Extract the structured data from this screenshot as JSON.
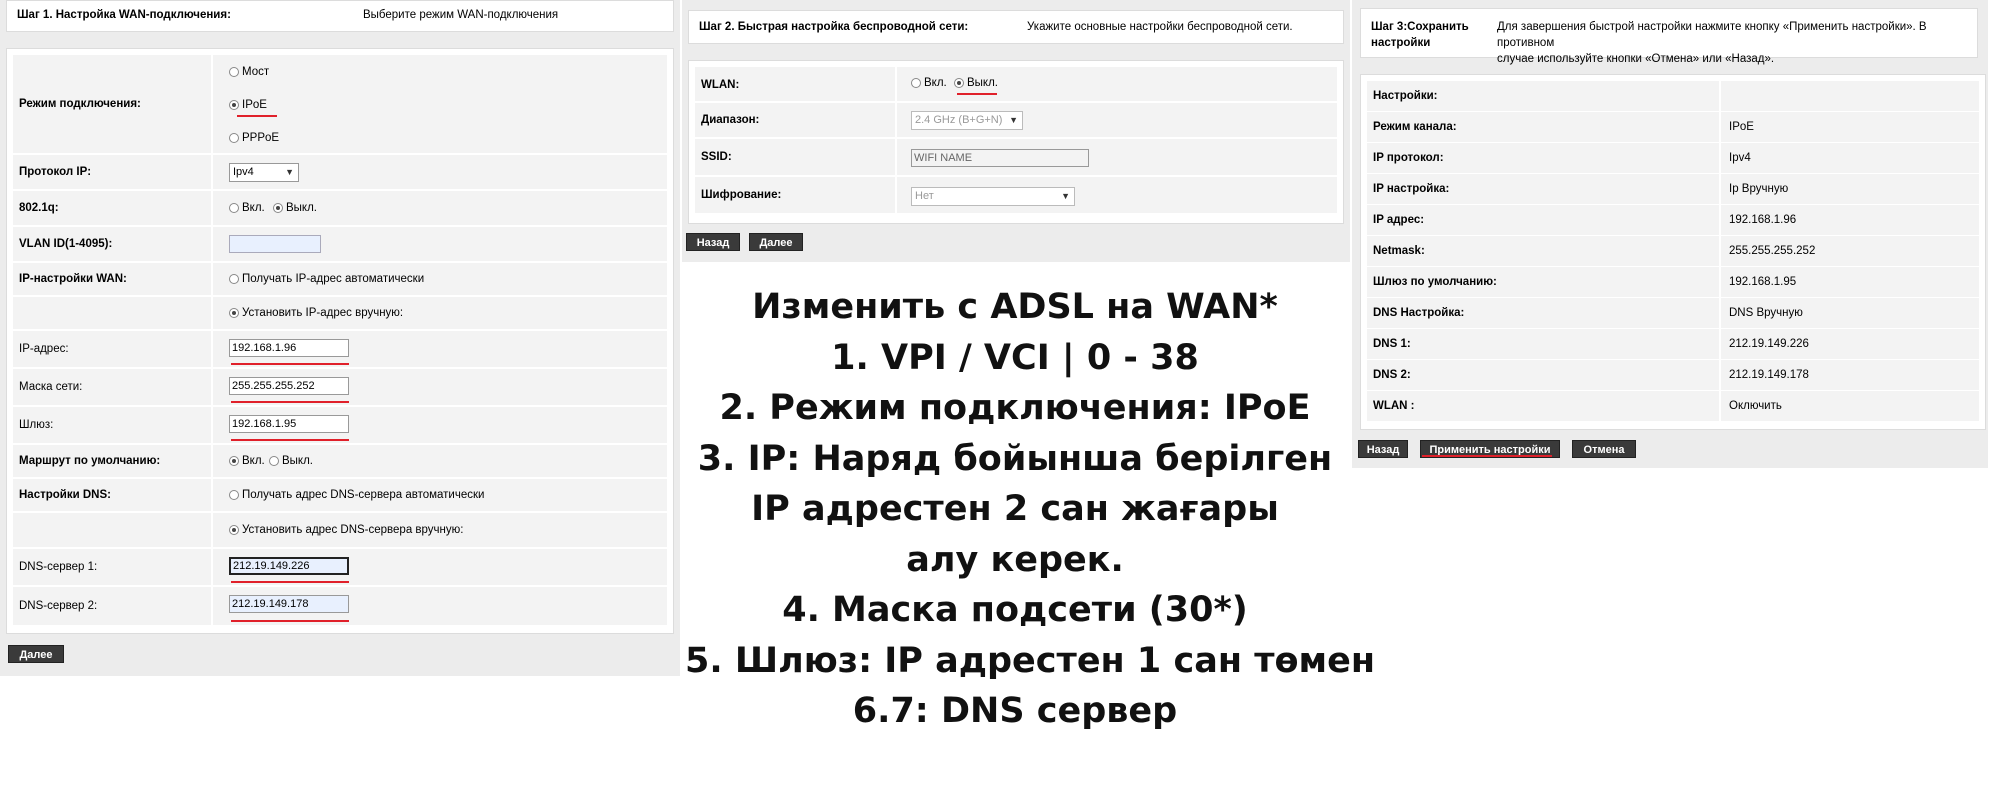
{
  "step1": {
    "header_label": "Шаг 1. Настройка WAN-подключения:",
    "header_desc": "Выберите режим WAN-подключения",
    "mode_label": "Режим подключения:",
    "mode_options": [
      "Мост",
      "IPoE",
      "PPPoE"
    ],
    "protocol_label": "Протокол IP:",
    "protocol_value": "Ipv4",
    "dot1q_label": "802.1q:",
    "on_label": "Вкл.",
    "off_label": "Выкл.",
    "vlan_label": "VLAN ID(1-4095):",
    "vlan_value": "",
    "wan_ip_label": "IP-настройки WAN:",
    "wan_ip_auto": "Получать IP-адрес автоматически",
    "wan_ip_manual": "Установить IP-адрес вручную:",
    "ip_label": "IP-адрес:",
    "ip_value": "192.168.1.96",
    "mask_label": "Маска сети:",
    "mask_value": "255.255.255.252",
    "gateway_label": "Шлюз:",
    "gateway_value": "192.168.1.95",
    "default_route_label": "Маршрут по умолчанию:",
    "dns_label": "Настройки DNS:",
    "dns_auto": "Получать адрес DNS-сервера автоматически",
    "dns_manual": "Установить адрес DNS-сервера вручную:",
    "dns1_label": "DNS-сервер 1:",
    "dns1_value": "212.19.149.226",
    "dns2_label": "DNS-сервер 2:",
    "dns2_value": "212.19.149.178",
    "next_button": "Далее"
  },
  "step2": {
    "header_label": "Шаг 2. Быстрая настройка беспроводной сети:",
    "header_desc": "Укажите основные настройки беспроводной сети.",
    "wlan_label": "WLAN:",
    "on_label": "Вкл.",
    "off_label": "Выкл.",
    "band_label": "Диапазон:",
    "band_value": "2.4 GHz (B+G+N)",
    "ssid_label": "SSID:",
    "ssid_value": "WIFI NAME",
    "enc_label": "Шифрование:",
    "enc_value": "Нет",
    "back_button": "Назад",
    "next_button": "Далее"
  },
  "step3": {
    "header_label_1": "Шаг 3:Сохранить",
    "header_label_2": "настройки",
    "header_desc_1": "Для завершения быстрой настройки нажмите кнопку «Применить настройки». В противном",
    "header_desc_2": "случае используйте кнопки «Отмена» или «Назад».",
    "rows": [
      {
        "label": "Настройки:",
        "value": ""
      },
      {
        "label": "Режим канала:",
        "value": "IPoE"
      },
      {
        "label": "IP протокол:",
        "value": "Ipv4"
      },
      {
        "label": "IP настройка:",
        "value": "Ip Вручную"
      },
      {
        "label": "IP адрес:",
        "value": "192.168.1.96"
      },
      {
        "label": "Netmask:",
        "value": "255.255.255.252"
      },
      {
        "label": "Шлюз по умолчанию:",
        "value": "192.168.1.95"
      },
      {
        "label": "DNS Настройка:",
        "value": "DNS Вручную"
      },
      {
        "label": "DNS 1:",
        "value": "212.19.149.226"
      },
      {
        "label": "DNS 2:",
        "value": "212.19.149.178"
      },
      {
        "label": "WLAN :",
        "value": "Оключить"
      }
    ],
    "back_button": "Назад",
    "apply_button": "Применить настройки",
    "cancel_button": "Отмена"
  },
  "instructions": [
    "Изменить с ADSL на WAN*",
    "1. VPI / VCI | 0 - 38",
    "2. Режим подключения: IPoE",
    "3. IP: Наряд бойынша берілген",
    "IP адрестен 2 сан жағары",
    "алу керек.",
    "4. Маска подсети (30*)",
    "5. Шлюз: IP адрестен 1 сан төмен",
    "6.7: DNS сервер"
  ],
  "colors": {
    "underline": "#e0202a",
    "button": "#3a3a3a",
    "panel": "#ececec"
  }
}
